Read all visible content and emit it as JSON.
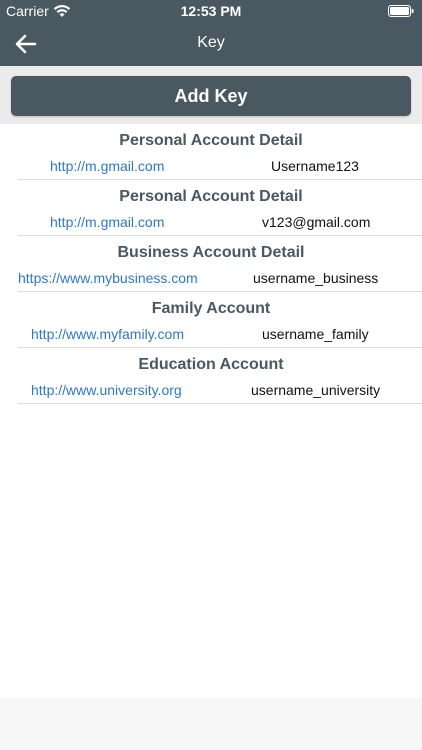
{
  "status_bar": {
    "carrier": "Carrier",
    "time": "12:53 PM"
  },
  "nav": {
    "title": "Key",
    "back_icon": "arrow-left-icon"
  },
  "add_key": {
    "label": "Add Key"
  },
  "accounts": [
    {
      "title": "Personal Account Detail",
      "url": "http://m.gmail.com",
      "username": "Username123"
    },
    {
      "title": "Personal Account Detail",
      "url": "http://m.gmail.com",
      "username": "v123@gmail.com"
    },
    {
      "title": "Business Account Detail",
      "url": "https://www.mybusiness.com",
      "username": "username_business"
    },
    {
      "title": "Family Account",
      "url": "http://www.myfamily.com",
      "username": "username_family"
    },
    {
      "title": "Education Account",
      "url": "http://www.university.org",
      "username": "username_university"
    }
  ],
  "colors": {
    "header": "#4a5862",
    "link": "#2f78c4",
    "title_text": "#4a5862"
  }
}
